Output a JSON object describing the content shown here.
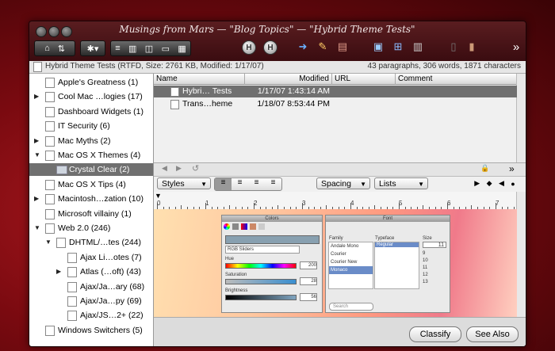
{
  "window": {
    "title": "Musings from Mars — \"Blog Topics\" — \"Hybrid Theme Tests\""
  },
  "toolbar": {
    "buttons": [
      {
        "name": "home-icon",
        "glyph": "⌂"
      },
      {
        "name": "sort-icon",
        "glyph": "⇅"
      },
      {
        "name": "gear-menu-button",
        "glyph": "✱▾"
      },
      {
        "name": "view-list-icon",
        "glyph": "≡"
      },
      {
        "name": "view-columns-icon",
        "glyph": "▥"
      },
      {
        "name": "view-split-icon",
        "glyph": "◫"
      },
      {
        "name": "view-wide-icon",
        "glyph": "▭"
      },
      {
        "name": "view-grid-icon",
        "glyph": "▦"
      }
    ],
    "overflow": "»"
  },
  "info_bar": {
    "document": "Hybrid Theme Tests (RTFD, Size: 2761 KB, Modified: 1/17/07)",
    "stats": "43 paragraphs, 306 words, 1871 characters"
  },
  "sidebar": {
    "items": [
      {
        "label": "Apple's Greatness (1)",
        "indent": 0,
        "disclosure": "",
        "icon": "doc",
        "selected": false
      },
      {
        "label": "Cool Mac …logies (17)",
        "indent": 0,
        "disclosure": "▶",
        "icon": "doc",
        "selected": false
      },
      {
        "label": "Dashboard Widgets (1)",
        "indent": 0,
        "disclosure": "",
        "icon": "doc",
        "selected": false
      },
      {
        "label": "IT Security (6)",
        "indent": 0,
        "disclosure": "",
        "icon": "doc",
        "selected": false
      },
      {
        "label": "Mac Myths (2)",
        "indent": 0,
        "disclosure": "▶",
        "icon": "doc",
        "selected": false
      },
      {
        "label": "Mac OS X Themes (4)",
        "indent": 0,
        "disclosure": "▼",
        "icon": "doc",
        "selected": false
      },
      {
        "label": "Crystal Clear (2)",
        "indent": 1,
        "disclosure": "",
        "icon": "folder",
        "selected": true
      },
      {
        "label": "Mac OS X Tips (4)",
        "indent": 0,
        "disclosure": "",
        "icon": "doc",
        "selected": false
      },
      {
        "label": "Macintosh…zation (10)",
        "indent": 0,
        "disclosure": "▶",
        "icon": "doc",
        "selected": false
      },
      {
        "label": "Microsoft villainy (1)",
        "indent": 0,
        "disclosure": "",
        "icon": "doc",
        "selected": false
      },
      {
        "label": "Web 2.0 (246)",
        "indent": 0,
        "disclosure": "▼",
        "icon": "doc",
        "selected": false
      },
      {
        "label": "DHTML/…tes (244)",
        "indent": 1,
        "disclosure": "▼",
        "icon": "doc",
        "selected": false
      },
      {
        "label": "Ajax Li…otes (7)",
        "indent": 2,
        "disclosure": "",
        "icon": "doc",
        "selected": false
      },
      {
        "label": "Atlas (…oft) (43)",
        "indent": 2,
        "disclosure": "▶",
        "icon": "doc",
        "selected": false
      },
      {
        "label": "Ajax/Ja…ary (68)",
        "indent": 2,
        "disclosure": "",
        "icon": "doc",
        "selected": false
      },
      {
        "label": "Ajax/Ja…py (69)",
        "indent": 2,
        "disclosure": "",
        "icon": "doc",
        "selected": false
      },
      {
        "label": "Ajax/JS…2+ (22)",
        "indent": 2,
        "disclosure": "",
        "icon": "doc",
        "selected": false
      },
      {
        "label": "Windows Switchers (5)",
        "indent": 0,
        "disclosure": "",
        "icon": "doc",
        "selected": false
      }
    ]
  },
  "table": {
    "columns": [
      "Name",
      "Modified",
      "URL",
      "Comment"
    ],
    "rows": [
      {
        "name": "Hybri… Tests",
        "modified": "1/17/07 1:43:14 AM",
        "url": "",
        "comment": "",
        "selected": true
      },
      {
        "name": "Trans…heme",
        "modified": "1/18/07 8:53:44 PM",
        "url": "",
        "comment": "",
        "selected": false
      }
    ]
  },
  "format_bar": {
    "styles": "Styles",
    "spacing": "Spacing",
    "lists": "Lists"
  },
  "ruler": {
    "labels": [
      "0",
      "1",
      "2",
      "3",
      "4",
      "5",
      "6",
      "7"
    ]
  },
  "embedded_image": {
    "colors_panel_title": "Colors",
    "colors_mode": "RGB Sliders",
    "slider_labels": [
      "Hue",
      "Saturation",
      "Brightness"
    ],
    "slider_values": [
      "200",
      "28",
      "56"
    ],
    "font_panel_title": "Font",
    "font_columns": [
      "Family",
      "Typeface",
      "Size"
    ],
    "families": [
      "Andale Mono",
      "Courier",
      "Courier New",
      "Monaco"
    ],
    "typefaces": [
      "Regular"
    ],
    "sizes": [
      "9",
      "10",
      "11",
      "12",
      "13"
    ],
    "size_value": "11",
    "search_placeholder": "Search"
  },
  "buttons": {
    "classify": "Classify",
    "see_also": "See Also"
  }
}
